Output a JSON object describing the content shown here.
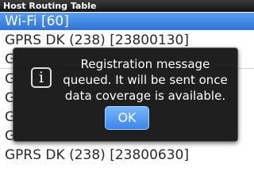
{
  "window": {
    "title": "Host Routing Table"
  },
  "list": {
    "items": [
      {
        "label": "Wi-Fi [60]"
      },
      {
        "label": "GPRS DK (238) [23800130]"
      },
      {
        "label": "G"
      },
      {
        "label": "G"
      },
      {
        "label": "G"
      },
      {
        "label": "G"
      },
      {
        "label": "G"
      },
      {
        "label": "GPRS DK (238) [23800630]"
      }
    ]
  },
  "dialog": {
    "icon": "info-icon",
    "icon_glyph": "i",
    "message": "Registration message queued. It will be sent once data coverage is available.",
    "ok_label": "OK"
  },
  "colors": {
    "selection": "#3d86e4",
    "dialog_background": "#0c0c0c",
    "button": "#4a94f0"
  }
}
